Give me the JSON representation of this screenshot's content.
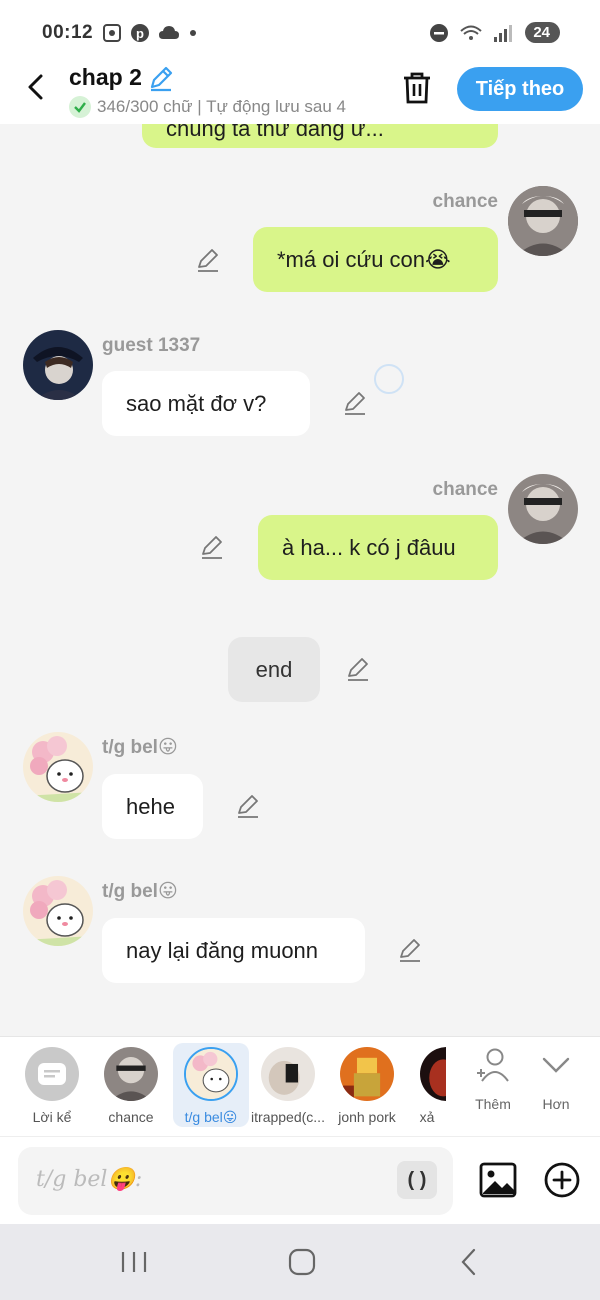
{
  "status_bar": {
    "time": "00:12",
    "battery": "24"
  },
  "header": {
    "title": "chap 2",
    "save_status": "346/300 chữ | Tự động lưu sau 4",
    "next_label": "Tiếp theo"
  },
  "messages": [
    {
      "sender": "",
      "text": "chúng ta thử đăng ư...",
      "side": "right"
    },
    {
      "sender": "chance",
      "text": "*má oi cứu con😭",
      "side": "right"
    },
    {
      "sender": "guest 1337",
      "text": "sao mặt đơ v?",
      "side": "left"
    },
    {
      "sender": "chance",
      "text": "à ha... k có j đâuu",
      "side": "right"
    },
    {
      "sender": "",
      "text": "end",
      "side": "center"
    },
    {
      "sender": "t/g bel😛",
      "text": "hehe",
      "side": "left"
    },
    {
      "sender": "t/g bel😛",
      "text": "nay lại đăng muonn",
      "side": "left"
    }
  ],
  "characters": [
    {
      "label": "Lời kể"
    },
    {
      "label": "chance"
    },
    {
      "label": "t/g bel😛"
    },
    {
      "label": "itrapped(c..."
    },
    {
      "label": "jonh pork"
    },
    {
      "label": "xả"
    }
  ],
  "actions": {
    "add_char": "Thêm",
    "more": "Hơn"
  },
  "input": {
    "placeholder": "t/g bel😛:",
    "paren": "( )"
  },
  "colors": {
    "accent": "#3aa0f0",
    "green_bubble": "#d9f58a",
    "white_bubble": "#ffffff"
  }
}
